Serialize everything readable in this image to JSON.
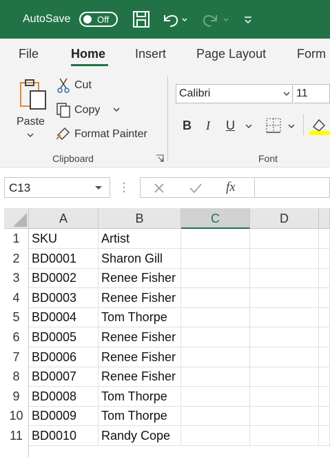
{
  "titlebar": {
    "autosave_label": "AutoSave",
    "autosave_state": "Off",
    "background": "#217346"
  },
  "tabs": [
    {
      "label": "File"
    },
    {
      "label": "Home"
    },
    {
      "label": "Insert"
    },
    {
      "label": "Page Layout"
    },
    {
      "label": "Form"
    }
  ],
  "ribbon": {
    "clipboard": {
      "paste_label": "Paste",
      "cut_label": "Cut",
      "copy_label": "Copy",
      "format_painter_label": "Format Painter",
      "group_label": "Clipboard"
    },
    "font": {
      "font_name": "Calibri",
      "font_size": "11",
      "bold": "B",
      "italic": "I",
      "underline": "U",
      "group_label": "Font"
    }
  },
  "formula_bar": {
    "name_box": "C13",
    "fx": "fx",
    "value": ""
  },
  "grid": {
    "columns": [
      "A",
      "B",
      "C",
      "D"
    ],
    "selected_column": "C",
    "rows": [
      {
        "num": "1",
        "a": "SKU",
        "b": "Artist"
      },
      {
        "num": "2",
        "a": "BD0001",
        "b": "Sharon Gill"
      },
      {
        "num": "3",
        "a": "BD0002",
        "b": "Renee Fisher"
      },
      {
        "num": "4",
        "a": "BD0003",
        "b": "Renee Fisher"
      },
      {
        "num": "5",
        "a": "BD0004",
        "b": "Tom Thorpe"
      },
      {
        "num": "6",
        "a": "BD0005",
        "b": "Renee Fisher"
      },
      {
        "num": "7",
        "a": "BD0006",
        "b": "Renee Fisher"
      },
      {
        "num": "8",
        "a": "BD0007",
        "b": "Renee Fisher"
      },
      {
        "num": "9",
        "a": "BD0008",
        "b": "Tom Thorpe"
      },
      {
        "num": "10",
        "a": "BD0009",
        "b": "Tom Thorpe"
      },
      {
        "num": "11",
        "a": "BD0010",
        "b": "Randy Cope"
      }
    ]
  },
  "colors": {
    "accent": "#217346",
    "ribbon_bg": "#f3f3f3"
  }
}
